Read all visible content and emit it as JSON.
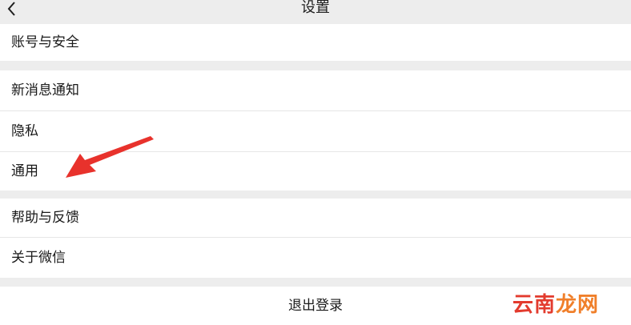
{
  "header": {
    "title": "设置",
    "back_icon": "chevron-left-icon"
  },
  "groups": [
    {
      "items": [
        "账号与安全"
      ]
    },
    {
      "items": [
        "新消息通知",
        "隐私",
        "通用"
      ]
    },
    {
      "items": [
        "帮助与反馈",
        "关于微信"
      ]
    }
  ],
  "logout": {
    "label": "退出登录"
  },
  "watermark": {
    "part1": "云南",
    "part2": "龙网"
  },
  "colors": {
    "background": "#ededed",
    "row": "#ffffff",
    "arrow": "#e8322c"
  }
}
